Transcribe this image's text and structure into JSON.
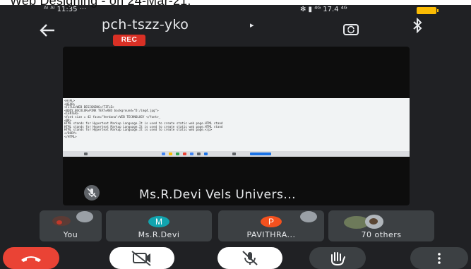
{
  "caption": "Web Designing - on 24-Mar-21.",
  "status": {
    "left": "ᴬᴵ ᴬᴵ 11:35 ···",
    "right": "✻ ▮ ⁴ᴳ 17.4 ⁴ᴳ"
  },
  "header": {
    "meeting_code": "pch-tszz-yko",
    "rec_label": "REC",
    "chevron": "▸"
  },
  "main_tile": {
    "presenter": "Ms.R.Devi Vels Univers...",
    "code_lines": [
      "<HTML>",
      "<HEAD>",
      "<TITLE>WEB DESIGNING</TITLE>",
      "<BODY BGCOLOR=PINK TEXT=RED background=\"D:/img4.jpg\">",
      "<CENTER>",
      "<font size = 42 face=\"Verdana\">VEB TECHNOLOGY </font>_",
      "<BR>",
      "HTML stands for Hypertext Markup Language.It is used to create static web page.HTML stand",
      "HTML stands for Hypertext Markup Language.It is used to create static web page.HTML stand",
      "HTML stands for Hypertext Markup Language.It is used to create static web page.</p>",
      "</BODY>",
      "</HTML>"
    ]
  },
  "participants": [
    {
      "label": "You"
    },
    {
      "label": "Ms.R.Devi",
      "initial": "M",
      "color": "#12a4af"
    },
    {
      "label": "PAVITHRA...",
      "initial": "P",
      "color": "#f4511e"
    },
    {
      "label": "70 others"
    }
  ],
  "controls": [
    "end-call",
    "camera-off",
    "mic-off",
    "raise-hand",
    "more-options"
  ]
}
